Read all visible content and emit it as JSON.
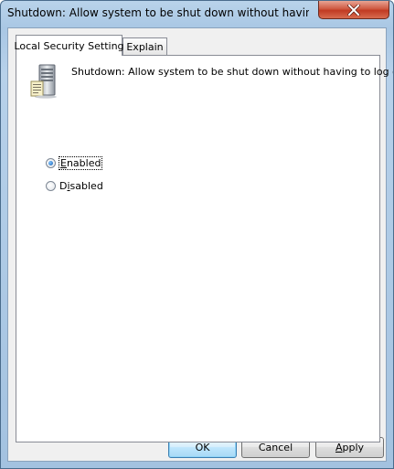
{
  "window": {
    "title": "Shutdown: Allow system to be shut down without having to l..."
  },
  "tabs": [
    {
      "label": "Local Security Setting",
      "active": true
    },
    {
      "label": "Explain",
      "active": false
    }
  ],
  "policy": {
    "description": "Shutdown: Allow system to be shut down without having to log on"
  },
  "options": {
    "enabled": {
      "pre": "",
      "mnemonic": "E",
      "post": "nabled",
      "checked": true
    },
    "disabled": {
      "pre": "D",
      "mnemonic": "i",
      "post": "sabled",
      "checked": false
    }
  },
  "buttons": {
    "ok": "OK",
    "cancel": "Cancel",
    "apply": {
      "pre": "",
      "mnemonic": "A",
      "post": "pply"
    }
  },
  "colors": {
    "close_button": "#c13a22",
    "default_button_border": "#3c7fb1"
  },
  "icons": {
    "close": "close-icon",
    "policy": "server-policy-icon"
  }
}
